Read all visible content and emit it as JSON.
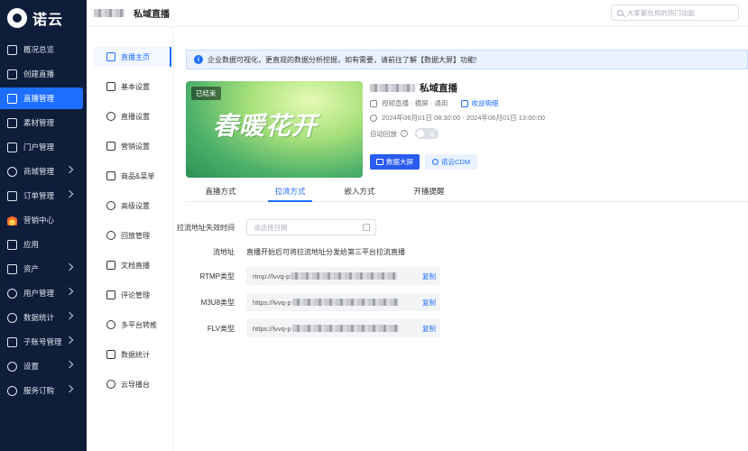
{
  "brand": {
    "name": "诺云"
  },
  "sidebar": {
    "items": [
      {
        "label": "概况总览",
        "icon": "dashboard-icon",
        "arrow": false,
        "active": false
      },
      {
        "label": "创建直播",
        "icon": "plus-square-icon",
        "arrow": false,
        "active": false
      },
      {
        "label": "直播管理",
        "icon": "live-icon",
        "arrow": false,
        "active": true
      },
      {
        "label": "素材管理",
        "icon": "folder-icon",
        "arrow": false,
        "active": false
      },
      {
        "label": "门户管理",
        "icon": "home-icon",
        "arrow": false,
        "active": false
      },
      {
        "label": "商城管理",
        "icon": "shop-icon",
        "arrow": true,
        "active": false
      },
      {
        "label": "订单管理",
        "icon": "order-icon",
        "arrow": true,
        "active": false
      },
      {
        "label": "营销中心",
        "icon": "fire-icon",
        "arrow": false,
        "active": false
      },
      {
        "label": "应用",
        "icon": "apps-icon",
        "arrow": false,
        "active": false
      },
      {
        "label": "资产",
        "icon": "wallet-icon",
        "arrow": true,
        "active": false
      },
      {
        "label": "用户管理",
        "icon": "user-icon",
        "arrow": true,
        "active": false
      },
      {
        "label": "数据统计",
        "icon": "chart-icon",
        "arrow": true,
        "active": false
      },
      {
        "label": "子账号管理",
        "icon": "sub-account-icon",
        "arrow": true,
        "active": false
      },
      {
        "label": "设置",
        "icon": "gear-icon",
        "arrow": true,
        "active": false
      },
      {
        "label": "服务订购",
        "icon": "service-icon",
        "arrow": true,
        "active": false
      }
    ]
  },
  "header": {
    "title": "私域直播",
    "search_placeholder": "大家都在用的热门功能"
  },
  "submenu": {
    "items": [
      {
        "label": "直播主页",
        "icon": "home-icon",
        "active": true
      },
      {
        "label": "基本设置",
        "icon": "edit-icon",
        "active": false
      },
      {
        "label": "直播设置",
        "icon": "live-settings-icon",
        "active": false
      },
      {
        "label": "营销设置",
        "icon": "marketing-icon",
        "active": false
      },
      {
        "label": "商品&菜单",
        "icon": "goods-icon",
        "active": false
      },
      {
        "label": "高级设置",
        "icon": "advanced-icon",
        "active": false
      },
      {
        "label": "回放管理",
        "icon": "replay-icon",
        "active": false
      },
      {
        "label": "文档直播",
        "icon": "document-icon",
        "active": false
      },
      {
        "label": "评论管理",
        "icon": "comment-icon",
        "active": false
      },
      {
        "label": "多平台转推",
        "icon": "share-icon",
        "active": false
      },
      {
        "label": "数据统计",
        "icon": "stats-icon",
        "active": false
      },
      {
        "label": "云导播台",
        "icon": "cloud-icon",
        "active": false
      }
    ]
  },
  "notice": {
    "text": "企业数据可视化，更直观的数据分析挖掘，如有需要，请前往了解【数据大屏】功能!"
  },
  "live": {
    "status_badge": "已结束",
    "cover_art_text": "春暖花开",
    "title": "私域直播",
    "type": "视频直播 · 横屏 · 通用",
    "income_link": "收益明细",
    "time_range": "2024年06月01日 08:30:00 - 2024年06月01日 13:00:00",
    "auto_replay_label": "自动回放",
    "auto_replay_state": "关",
    "buttons": {
      "data_screen": "数据大屏",
      "cdm": "诺云CDM"
    }
  },
  "tabs": [
    {
      "label": "直播方式",
      "active": false
    },
    {
      "label": "拉流方式",
      "active": true
    },
    {
      "label": "嵌入方式",
      "active": false
    },
    {
      "label": "开播提醒",
      "active": false
    }
  ],
  "pull_stream": {
    "expire_label": "拉流地址失效时间",
    "expire_placeholder": "请选择日期",
    "stream_label": "流地址",
    "stream_desc": "直播开始后可将拉流地址分发给第三平台拉流直播",
    "rtmp": {
      "label": "RTMP类型",
      "prefix": "rtmp://lvvq-p",
      "copy": "复制"
    },
    "m3u8": {
      "label": "M3U8类型",
      "prefix": "https://lvvq-p",
      "copy": "复制"
    },
    "flv": {
      "label": "FLV类型",
      "prefix": "https://lvvq-p",
      "copy": "复制"
    }
  }
}
